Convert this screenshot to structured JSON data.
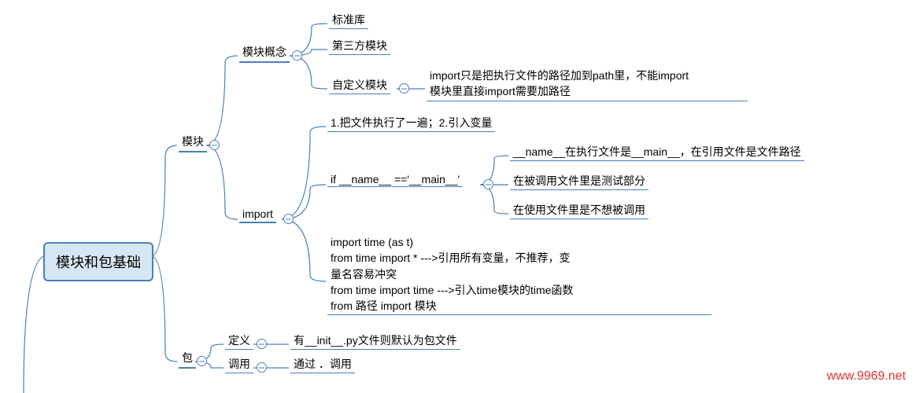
{
  "root": "模块和包基础",
  "n": {
    "mod": "模块",
    "pkg": "包",
    "concept": "模块概念",
    "imp": "import",
    "std": "标准库",
    "third": "第三方模块",
    "custom": "自定义模块",
    "custom_note": "import只是把执行文件的路径加到path里，不能import\n模块里直接import需要加路径",
    "imp1": "1.把文件执行了一遍；2.引入变量",
    "ifname": "if __name__ =='__main__'",
    "ifn1": "__name__在执行文件是__main__，在引用文件是文件路径",
    "ifn2": "在被调用文件里是测试部分",
    "ifn3": "在使用文件里是不想被调用",
    "syntax": "import time (as t)\nfrom time import *       --->引用所有变量，不推荐，变\n量名容易冲突\nfrom time import time --->引入time模块的time函数\nfrom 路径 import 模块",
    "def": "定义",
    "call": "调用",
    "def_note": "有__init__.py文件则默认为包文件",
    "call_note": "通过 ．调用"
  },
  "watermark": "www.9969.net"
}
